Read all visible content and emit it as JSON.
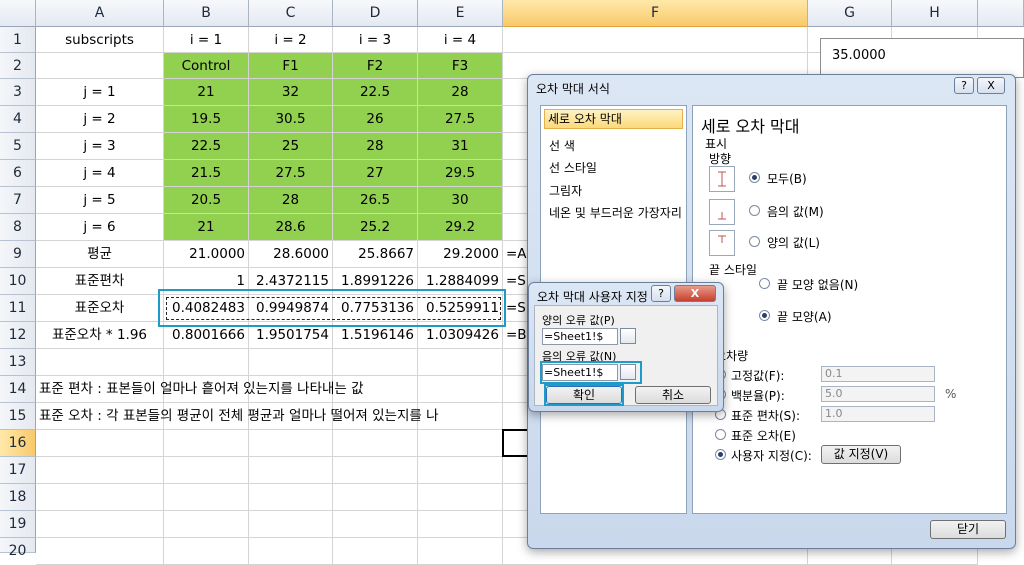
{
  "columns": [
    "A",
    "B",
    "C",
    "D",
    "E",
    "F",
    "G",
    "H"
  ],
  "rows": [
    "1",
    "2",
    "3",
    "4",
    "5",
    "6",
    "7",
    "8",
    "9",
    "10",
    "11",
    "12",
    "13",
    "14",
    "15",
    "16",
    "17",
    "18",
    "19",
    "20"
  ],
  "cells": {
    "r1": [
      "subscripts",
      "i = 1",
      "i = 2",
      "i = 3",
      "i = 4"
    ],
    "r2": [
      "",
      "Control",
      "F1",
      "F2",
      "F3"
    ],
    "r3": [
      "j = 1",
      "21",
      "32",
      "22.5",
      "28"
    ],
    "r4": [
      "j = 2",
      "19.5",
      "30.5",
      "26",
      "27.5"
    ],
    "r5": [
      "j = 3",
      "22.5",
      "25",
      "28",
      "31"
    ],
    "r6": [
      "j = 4",
      "21.5",
      "27.5",
      "27",
      "29.5"
    ],
    "r7": [
      "j = 5",
      "20.5",
      "28",
      "26.5",
      "30"
    ],
    "r8": [
      "j = 6",
      "21",
      "28.6",
      "25.2",
      "29.2"
    ],
    "r9": [
      "평균",
      "21.0000",
      "28.6000",
      "25.8667",
      "29.2000",
      "=A"
    ],
    "r10": [
      "표준편차",
      "1",
      "2.4372115",
      "1.8991226",
      "1.2884099",
      "=S"
    ],
    "r11": [
      "표준오차",
      "0.4082483",
      "0.9949874",
      "0.7753136",
      "0.5259911",
      "=S"
    ],
    "r12": [
      "표준오차 * 1.96",
      "0.8001666",
      "1.9501754",
      "1.5196146",
      "1.0309426",
      "=B"
    ],
    "r14": "표준 편차 : 표본들이 얼마나 흩어져 있는지를 나타내는 값",
    "r15": "표준 오차 : 각 표본들의 평균이 전체 평균과 얼마나 떨어져 있는지를 나"
  },
  "chart_tick": "35.0000",
  "format_dialog": {
    "title": "오차 막대 서식",
    "help": "?",
    "close": "X",
    "nav": [
      "세로 오차 막대",
      "선 색",
      "선 스타일",
      "그림자",
      "네온 및 부드러운 가장자리"
    ],
    "heading": "세로 오차 막대",
    "display_label": "표시",
    "direction_label": "방향",
    "direction_options": [
      "모두(B)",
      "음의 값(M)",
      "양의 값(L)"
    ],
    "endstyle_label": "끝 스타일",
    "endstyle_options": [
      "끝 모양 없음(N)",
      "끝 모양(A)"
    ],
    "amount_label": "오차량",
    "amount_options": [
      "고정값(F):",
      "백분율(P):",
      "표준 편차(S):",
      "표준 오차(E)",
      "사용자 지정(C):"
    ],
    "amount_values": [
      "0.1",
      "5.0",
      "1.0"
    ],
    "percent_unit": "%",
    "set_value_button": "값 지정(V)",
    "close_button": "닫기"
  },
  "custom_dialog": {
    "title": "오차 막대 사용자 지정",
    "help": "?",
    "close": "X",
    "positive_label": "양의 오류 값(P)",
    "positive_value": "=Sheet1!$",
    "negative_label": "음의 오류 값(N)",
    "negative_value": "=Sheet1!$",
    "ok": "확인",
    "cancel": "취소"
  }
}
